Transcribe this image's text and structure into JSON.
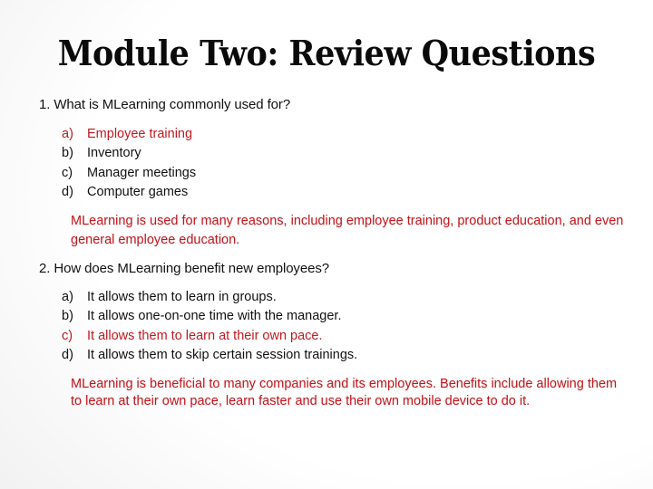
{
  "slide": {
    "title": "Module Two: Review Questions",
    "colors": {
      "answer_red": "#c0191f",
      "text_black": "#111111"
    },
    "questions": [
      {
        "prompt": "1. What is MLearning commonly used for?",
        "options": [
          {
            "letter": "a)",
            "text": "Employee training",
            "correct": true
          },
          {
            "letter": "b)",
            "text": "Inventory",
            "correct": false
          },
          {
            "letter": "c)",
            "text": "Manager meetings",
            "correct": false
          },
          {
            "letter": "d)",
            "text": "Computer games",
            "correct": false
          }
        ],
        "explanation": "MLearning is used for many reasons, including employee training, product education, and even general employee education."
      },
      {
        "prompt": "2. How does MLearning benefit new employees?",
        "options": [
          {
            "letter": "a)",
            "text": "It allows them to learn in groups.",
            "correct": false
          },
          {
            "letter": "b)",
            "text": "It allows one-on-one time with the manager.",
            "correct": false
          },
          {
            "letter": "c)",
            "text": "It allows them to learn at their own pace.",
            "correct": true
          },
          {
            "letter": "d)",
            "text": "It allows them to skip certain session trainings.",
            "correct": false
          }
        ],
        "explanation": "MLearning is beneficial to many companies and its employees.  Benefits include allowing them to learn at their own pace, learn faster and use their own mobile device to do it."
      }
    ]
  }
}
